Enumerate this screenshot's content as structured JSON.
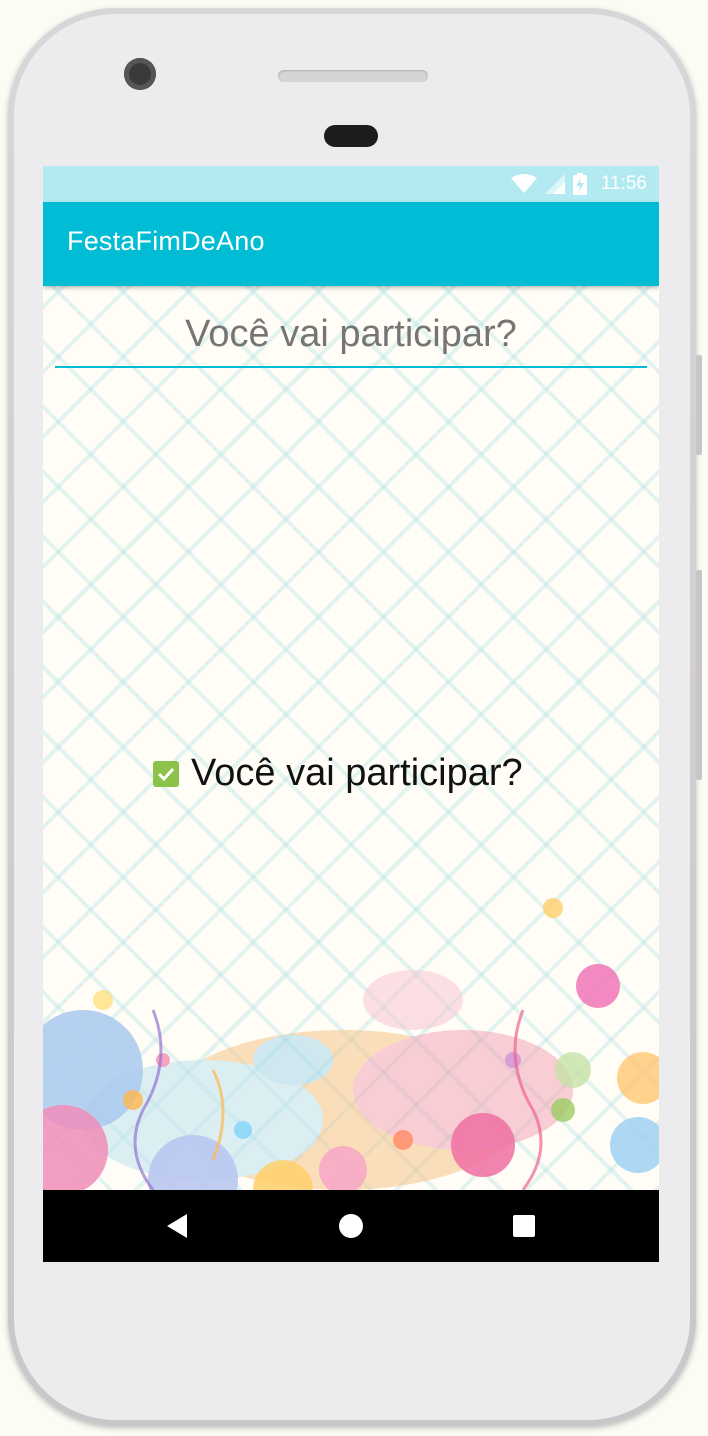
{
  "status_bar": {
    "time": "11:56",
    "icons": [
      "wifi-icon",
      "signal-icon",
      "battery-charging-icon"
    ]
  },
  "app_bar": {
    "title": "FestaFimDeAno"
  },
  "form": {
    "input_placeholder": "Você vai participar?",
    "input_value": "",
    "checkbox_label": "Você vai participar?",
    "checkbox_checked": true
  },
  "nav_bar": {
    "icons": [
      "back-icon",
      "home-icon",
      "recents-icon"
    ]
  },
  "colors": {
    "primary": "#00bcd4",
    "status_bar": "#b3eaf1",
    "checkbox": "#8bc34a",
    "nav_bar": "#000000"
  }
}
